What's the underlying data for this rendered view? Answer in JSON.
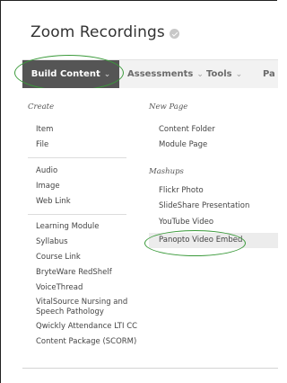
{
  "page": {
    "title": "Zoom Recordings"
  },
  "toolbar": {
    "build_content": "Build Content",
    "assessments": "Assessments",
    "tools": "Tools",
    "partial": "Pa"
  },
  "menu": {
    "create_heading": "Create",
    "create_items": [
      "Item",
      "File",
      "Audio",
      "Image",
      "Web Link",
      "Learning Module",
      "Syllabus",
      "Course Link",
      "BryteWare RedShelf",
      "VoiceThread",
      "VitalSource Nursing and Speech Pathology",
      "Qwickly Attendance LTI CC",
      "Content Package (SCORM)"
    ],
    "new_page_heading": "New Page",
    "new_page_items": [
      "Content Folder",
      "Module Page"
    ],
    "mashups_heading": "Mashups",
    "mashups_items": [
      "Flickr Photo",
      "SlideShare Presentation",
      "YouTube Video",
      "Panopto Video Embed"
    ]
  },
  "colors": {
    "highlight_oval": "#3a9a3a",
    "build_button": "#555555"
  }
}
